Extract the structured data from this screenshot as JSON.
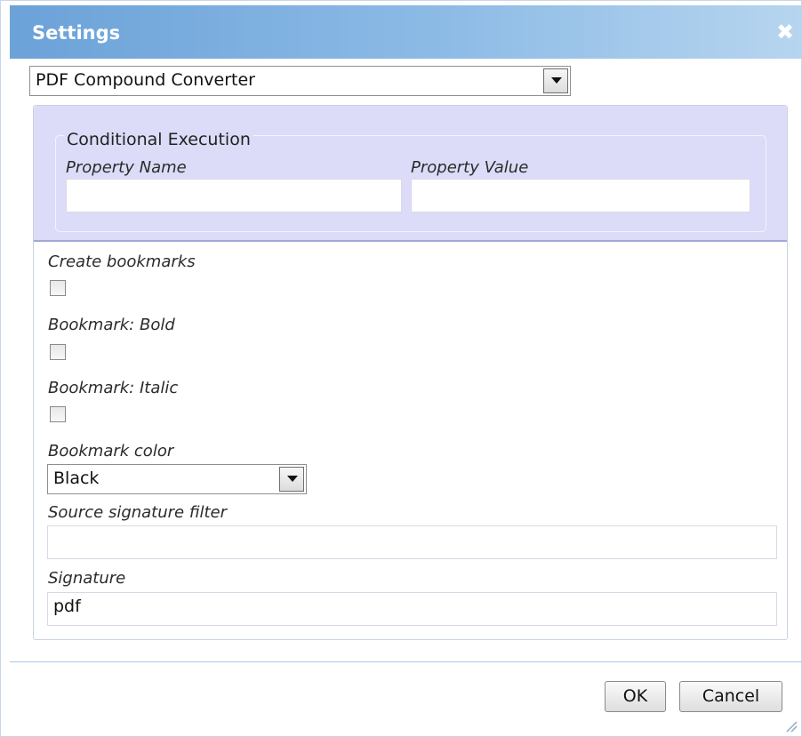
{
  "dialog": {
    "title": "Settings",
    "close_icon": "close-icon"
  },
  "converter_select": {
    "value": "PDF Compound Converter"
  },
  "conditional_execution": {
    "legend": "Conditional Execution",
    "property_name_label": "Property Name",
    "property_name_value": "",
    "property_value_label": "Property Value",
    "property_value_value": ""
  },
  "options": {
    "create_bookmarks_label": "Create bookmarks",
    "create_bookmarks_checked": false,
    "bookmark_bold_label": "Bookmark: Bold",
    "bookmark_bold_checked": false,
    "bookmark_italic_label": "Bookmark: Italic",
    "bookmark_italic_checked": false,
    "bookmark_color_label": "Bookmark color",
    "bookmark_color_value": "Black",
    "source_signature_filter_label": "Source signature filter",
    "source_signature_filter_value": "",
    "signature_label": "Signature",
    "signature_value": "pdf"
  },
  "footer": {
    "ok_label": "OK",
    "cancel_label": "Cancel"
  },
  "colors": {
    "titlebar_start": "#6ba2d8",
    "titlebar_end": "#b7d5ef",
    "conditional_bg": "#dcdcf8"
  }
}
